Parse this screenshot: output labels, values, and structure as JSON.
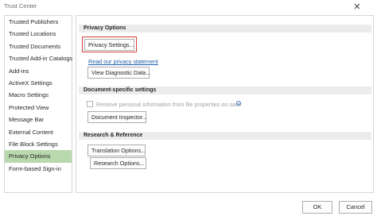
{
  "window": {
    "title": "Trust Center",
    "close_glyph": "✕"
  },
  "sidebar": {
    "items": [
      {
        "label": "Trusted Publishers"
      },
      {
        "label": "Trusted Locations"
      },
      {
        "label": "Trusted Documents"
      },
      {
        "label": "Trusted Add-in Catalogs"
      },
      {
        "label": "Add-ins"
      },
      {
        "label": "ActiveX Settings"
      },
      {
        "label": "Macro Settings"
      },
      {
        "label": "Protected View"
      },
      {
        "label": "Message Bar"
      },
      {
        "label": "External Content"
      },
      {
        "label": "File Block Settings"
      },
      {
        "label": "Privacy Options"
      },
      {
        "label": "Form-based Sign-in"
      }
    ],
    "active_index": 11
  },
  "privacy": {
    "header": "Privacy Options",
    "privacy_settings_btn": "Privacy Settings...",
    "privacy_statement_link": "Read our privacy statement",
    "diagnostic_btn": "View Diagnostic Data..."
  },
  "document_specific": {
    "header": "Document-specific settings",
    "remove_info_label": "Remove personal information from file properties on save",
    "remove_info_checked": false,
    "inspector_btn": "Document Inspector..."
  },
  "research": {
    "header": "Research & Reference",
    "translation_btn": "Translation Options...",
    "research_btn": "Research Options..."
  },
  "footer": {
    "ok_label": "OK",
    "cancel_label": "Cancel"
  },
  "colors": {
    "active_item": "#b9d8ad",
    "highlight": "#d23c3c",
    "link": "#1e5ea8"
  },
  "icons": {
    "info": "info-icon",
    "close": "close-icon"
  }
}
